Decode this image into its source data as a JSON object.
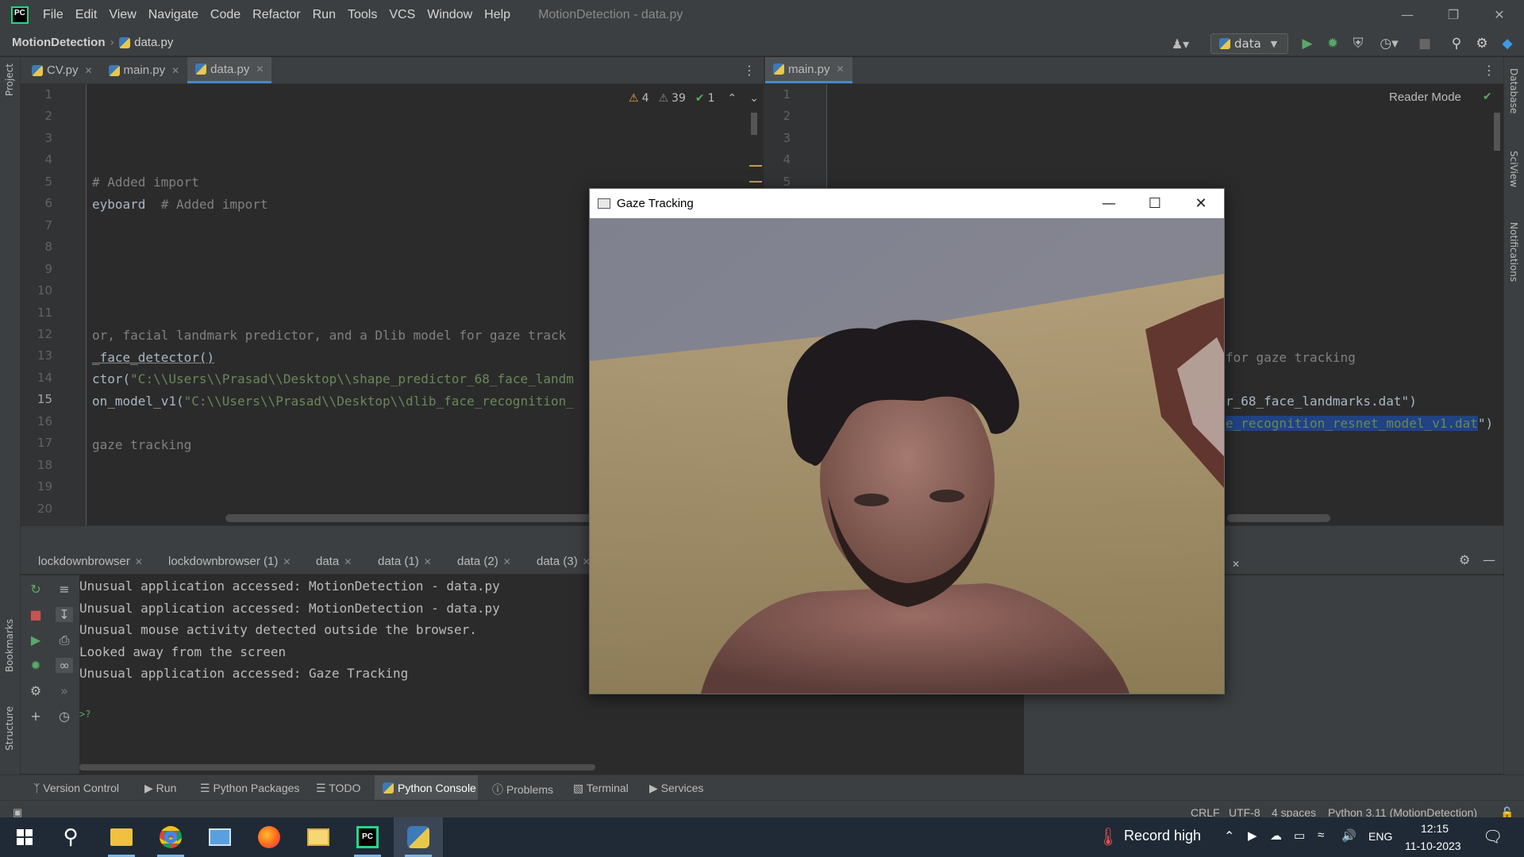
{
  "window": {
    "title": "MotionDetection - data.py",
    "menu": [
      "File",
      "Edit",
      "View",
      "Navigate",
      "Code",
      "Refactor",
      "Run",
      "Tools",
      "VCS",
      "Window",
      "Help"
    ]
  },
  "navbar": {
    "project": "MotionDetection",
    "file": "data.py",
    "run_config": "data"
  },
  "left_stripe": {
    "project": "Project",
    "bookmarks": "Bookmarks",
    "structure": "Structure"
  },
  "right_stripe": {
    "database": "Database",
    "sciview": "SciView",
    "notifications": "Notifications"
  },
  "editor_left": {
    "tabs": [
      {
        "label": "CV.py",
        "active": false
      },
      {
        "label": "main.py",
        "active": false
      },
      {
        "label": "data.py",
        "active": true
      }
    ],
    "inspections": {
      "warnings": "4",
      "weak_warnings": "39",
      "typos": "1"
    },
    "line_numbers": [
      "1",
      "2",
      "3",
      "4",
      "5",
      "6",
      "7",
      "8",
      "9",
      "10",
      "11",
      "12",
      "13",
      "14",
      "15",
      "16",
      "17",
      "18",
      "19",
      "20"
    ],
    "lines": {
      "l5": "# Added import",
      "l6_code": "eyboard  ",
      "l6_comment": "# Added import",
      "l12": "or, facial landmark predictor, and a Dlib model for gaze track",
      "l13": "_face_detector()",
      "l14_code": "ctor(",
      "l14_str": "\"C:\\\\Users\\\\Prasad\\\\Desktop\\\\shape_predictor_68_face_landm",
      "l15_code": "on_model_v1(",
      "l15_str": "\"C:\\\\Users\\\\Prasad\\\\Desktop\\\\dlib_face_recognition_",
      "l17": "gaze tracking"
    }
  },
  "editor_right": {
    "tab": "main.py",
    "reader_mode": "Reader Mode",
    "line_numbers": [
      "1",
      "2",
      "3",
      "4",
      "5"
    ],
    "lines": {
      "l13": "for gaze tracking",
      "l15": "r_68_face_landmarks.dat\")",
      "l16_sel": "e_recognition_resnet_model_v1.dat",
      "l16_tail": "\")"
    }
  },
  "console": {
    "tabs": [
      "lockdownbrowser",
      "lockdownbrowser (1)",
      "data",
      "data (1)",
      "data (2)",
      "data (3)"
    ],
    "lines": [
      "Unusual application accessed: MotionDetection - data.py",
      "Unusual application accessed: MotionDetection - data.py",
      "Unusual mouse activity detected outside the browser.",
      "Looked away from the screen",
      "Unusual application accessed: Gaze Tracking"
    ],
    "prompt": ">?"
  },
  "tool_windows": [
    "Version Control",
    "Run",
    "Python Packages",
    "TODO",
    "Python Console",
    "Problems",
    "Terminal",
    "Services"
  ],
  "active_tool_window": "Python Console",
  "status": {
    "line_sep": "CRLF",
    "encoding": "UTF-8",
    "indent": "4 spaces",
    "interpreter": "Python 3.11 (MotionDetection)"
  },
  "gaze_window": {
    "title": "Gaze Tracking"
  },
  "taskbar": {
    "weather": "Record high",
    "lang": "ENG",
    "time": "12:15",
    "date": "11-10-2023"
  },
  "colors": {
    "accent": "#4a88c7",
    "editor_bg": "#2b2b2b",
    "chrome": "#3c3f41",
    "taskbar": "#1f2a36"
  }
}
